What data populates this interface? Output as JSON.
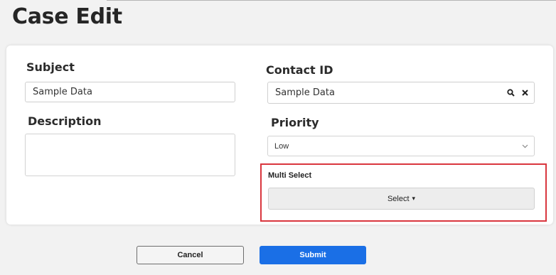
{
  "page": {
    "title": "Case Edit"
  },
  "form": {
    "subject": {
      "label": "Subject",
      "value": "Sample Data"
    },
    "description": {
      "label": "Description",
      "value": ""
    },
    "contact_id": {
      "label": "Contact ID",
      "value": "Sample Data",
      "search_icon": "search-icon",
      "clear_icon": "close-icon"
    },
    "priority": {
      "label": "Priority",
      "selected": "Low",
      "chevron_icon": "chevron-down-icon"
    },
    "multi_select": {
      "label": "Multi Select",
      "button_label": "Select",
      "caret": "▾",
      "highlight_color": "#d9363e"
    }
  },
  "actions": {
    "cancel_label": "Cancel",
    "submit_label": "Submit",
    "submit_color": "#1a6fe6"
  }
}
